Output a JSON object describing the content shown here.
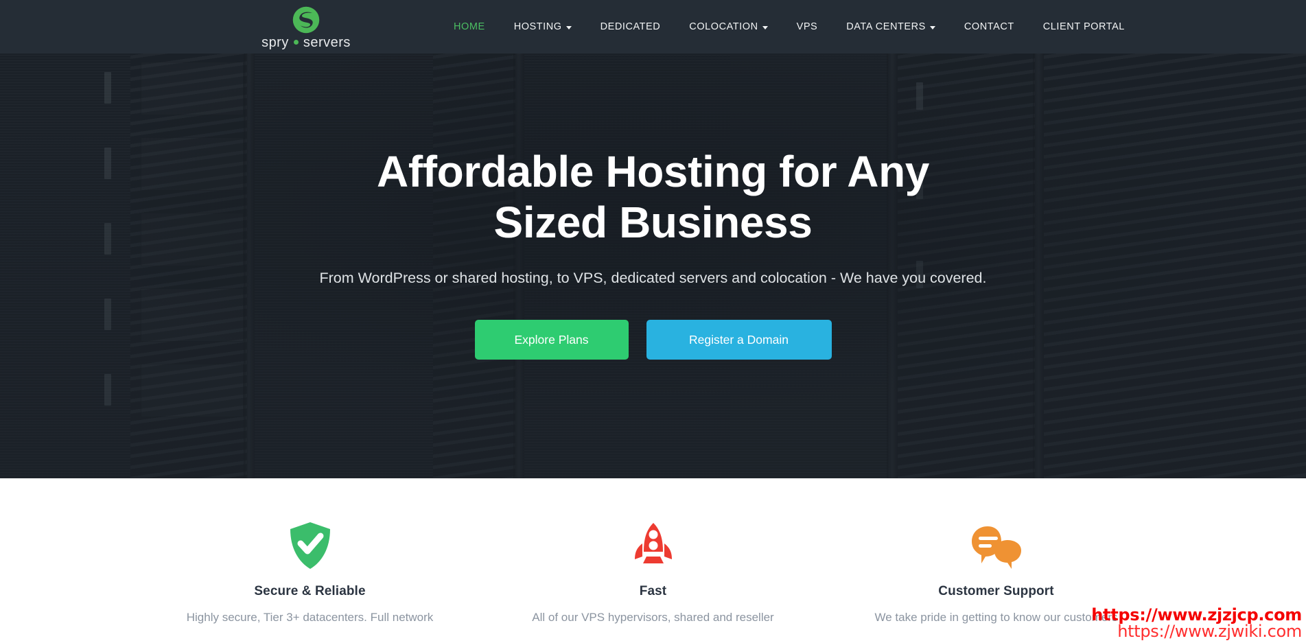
{
  "brand": {
    "name_part1": "spry",
    "name_part2": "servers",
    "logo_icon": "spry-circle-s-logo",
    "logo_color": "#4cb857"
  },
  "nav": {
    "items": [
      {
        "label": "HOME",
        "active": true,
        "has_dropdown": false
      },
      {
        "label": "HOSTING",
        "active": false,
        "has_dropdown": true
      },
      {
        "label": "DEDICATED",
        "active": false,
        "has_dropdown": false
      },
      {
        "label": "COLOCATION",
        "active": false,
        "has_dropdown": true
      },
      {
        "label": "VPS",
        "active": false,
        "has_dropdown": false
      },
      {
        "label": "DATA CENTERS",
        "active": false,
        "has_dropdown": true
      },
      {
        "label": "CONTACT",
        "active": false,
        "has_dropdown": false
      },
      {
        "label": "CLIENT PORTAL",
        "active": false,
        "has_dropdown": false
      }
    ],
    "active_color": "#4cbf63",
    "text_color": "#f2f4f5",
    "background": "#252d36"
  },
  "hero": {
    "title": "Affordable Hosting for Any Sized Business",
    "subtitle": "From WordPress or shared hosting, to VPS, dedicated servers and colocation - We have you covered.",
    "primary_button": {
      "label": "Explore Plans",
      "color": "#2ecc71"
    },
    "secondary_button": {
      "label": "Register a Domain",
      "color": "#29b2e0"
    },
    "background_image": "datacenter-server-racks-photo"
  },
  "features": [
    {
      "icon": "shield-check-icon",
      "icon_color": "#3bbd6b",
      "title": "Secure & Reliable",
      "description": "Highly secure, Tier 3+ datacenters. Full network"
    },
    {
      "icon": "rocket-icon",
      "icon_color": "#ed3b31",
      "title": "Fast",
      "description": "All of our VPS hypervisors, shared and reseller"
    },
    {
      "icon": "chat-bubbles-icon",
      "icon_color": "#ef9233",
      "title": "Customer Support",
      "description": "We take pride in getting to know our customers"
    }
  ],
  "watermark": {
    "line1": "https://www.zjzjcp.com",
    "line2": "https://www.zjwiki.com",
    "color": "#f40000"
  }
}
